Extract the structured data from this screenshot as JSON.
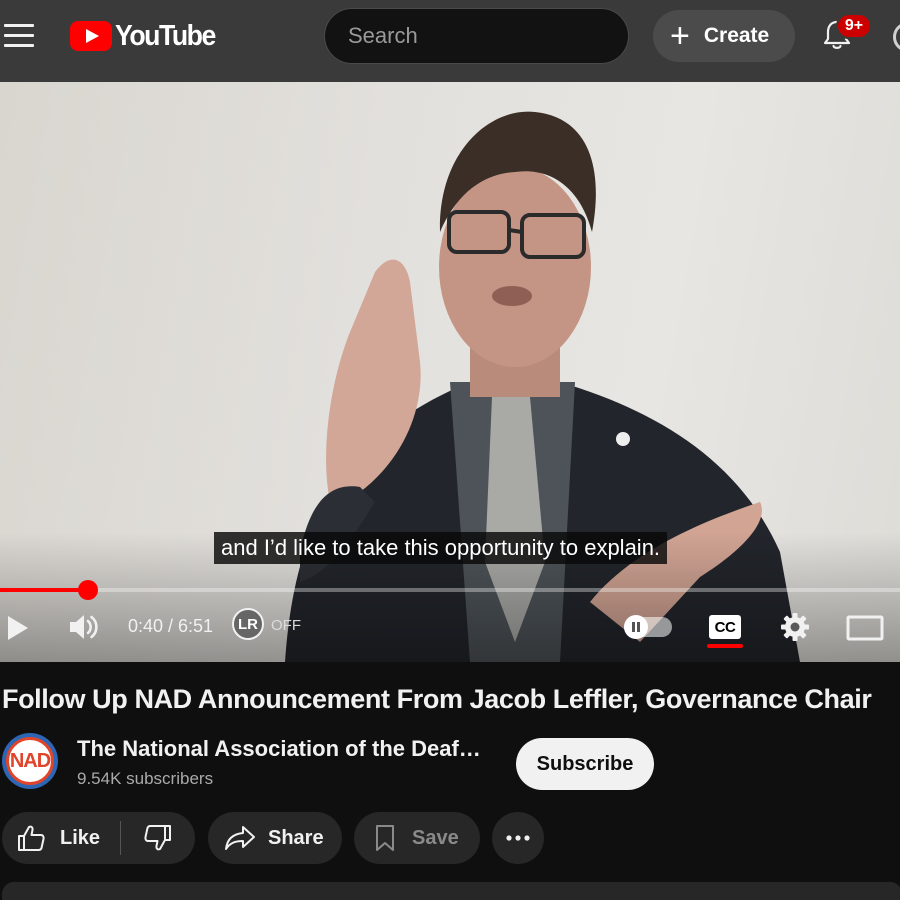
{
  "header": {
    "logo_text": "YouTube",
    "search_placeholder": "Search",
    "create_label": "Create",
    "notification_count": "9+",
    "icons": [
      "menu-icon",
      "search-icon",
      "plus-icon",
      "bell-icon"
    ]
  },
  "player": {
    "caption": "and I’d like to take this opportunity to explain.",
    "current_time": "0:40",
    "duration": "6:51",
    "time_display": "0:40 / 6:51",
    "progress_fraction": 0.0973,
    "lr_badge": "LR",
    "lr_state": "OFF",
    "cc_label": "CC",
    "captions_on": true,
    "autoplay_on": false,
    "accent_color": "#ff0000"
  },
  "video": {
    "title": "Follow Up NAD Announcement From Jacob Leffler, Governance Chair",
    "channel_name": "The National Association of the Deaf…",
    "channel_avatar_text": "NAD",
    "subscribers": "9.54K subscribers",
    "subscribe_label": "Subscribe"
  },
  "actions": {
    "like_label": "Like",
    "share_label": "Share",
    "save_label": "Save"
  }
}
